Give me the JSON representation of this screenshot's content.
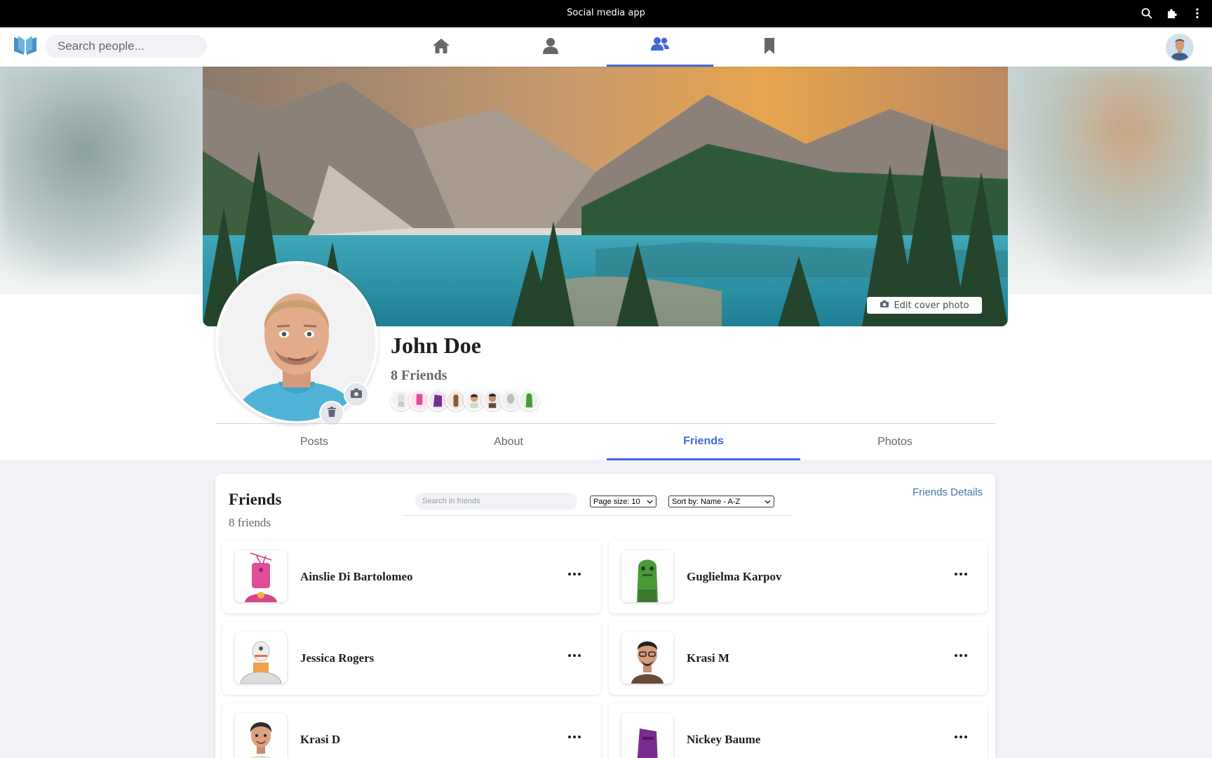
{
  "window": {
    "title": "Social media app"
  },
  "navbar": {
    "search_placeholder": "Search people...",
    "tabs": [
      {
        "icon": "home-icon"
      },
      {
        "icon": "person-icon"
      },
      {
        "icon": "friends-icon",
        "active": true
      },
      {
        "icon": "bookmark-icon"
      }
    ],
    "accent": "#4267d6"
  },
  "profile": {
    "name": "John Doe",
    "friends_count_label": "8 Friends",
    "edit_cover_label": "Edit cover photo",
    "tabs": [
      "Posts",
      "About",
      "Friends",
      "Photos"
    ],
    "active_tab": "Friends"
  },
  "friends_panel": {
    "title": "Friends",
    "subtitle": "8 friends",
    "search_placeholder": "Search in friends",
    "page_size_label": "Page size: 10",
    "sort_label": "Sort by: Name - A-Z",
    "details_link": "Friends Details",
    "friends": [
      {
        "name": "Ainslie Di Bartolomeo"
      },
      {
        "name": "Guglielma Karpov"
      },
      {
        "name": "Jessica Rogers"
      },
      {
        "name": "Krasi M"
      },
      {
        "name": "Krasi D"
      },
      {
        "name": "Nickey Baume"
      }
    ]
  }
}
